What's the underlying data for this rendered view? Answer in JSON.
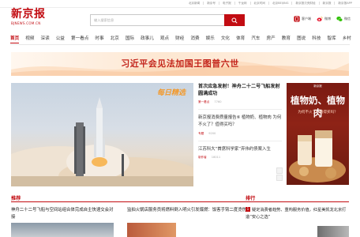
{
  "top_links": [
    "北京新闻",
    "新京号",
    "电子报",
    "千龙网",
    "北京时间",
    "北京BEIJING",
    "新京报贝壳财经",
    "新京报",
    "新京报APP"
  ],
  "logo": {
    "main": "新京报",
    "sub": "BJNEWS.COM.CN"
  },
  "search": {
    "placeholder": "输入搜索信息"
  },
  "header_tools": [
    {
      "label": "客户端",
      "icon": "phone-app-icon"
    },
    {
      "label": "微博",
      "icon": "weibo-icon"
    },
    {
      "label": "微信",
      "icon": "wechat-icon"
    }
  ],
  "nav": {
    "active": "首页",
    "items": [
      "首页",
      "视频",
      "深读",
      "公益",
      "第一看点",
      "时事",
      "北京",
      "国际",
      "政事儿",
      "观点",
      "财经",
      "消费",
      "娱乐",
      "文化",
      "体育",
      "汽车",
      "房产",
      "教育",
      "图说",
      "科技",
      "智库",
      "乡村"
    ]
  },
  "banner": {
    "text": "习近平会见法加国王图普六世"
  },
  "hero": {
    "tag": "每日精选"
  },
  "headline": {
    "title": "首次应急发射！神舟二十二号飞船发射圆满成功",
    "source": "第一看点",
    "count": "7760"
  },
  "news_items": [
    {
      "title": "新京报消费质量报告⑥ 植物奶、植物肉 为何不火了？值得买吗？",
      "source": "专题",
      "count": "9200"
    },
    {
      "title": "江苏科大“首席科学家”弃伟约债案入生",
      "source": "制作者",
      "count": "18011"
    }
  ],
  "poster": {
    "top": "新京报",
    "headline": "植物奶、植物肉",
    "sub": "为何不火了？值得买吗？"
  },
  "recommend": {
    "title": "推荐",
    "items": [
      "神舟二十二号飞船与空间站组合体完成自主快速交会对接",
      "监拍火锅店服务员将燃料倒入明火引发爆燃：饭客手臂二度烫伤"
    ]
  },
  "ranking": {
    "title": "排行",
    "items": [
      {
        "num": "1",
        "text": "疑定消费者趋势、重构服务价值，红星美凯龙北京打造“安心之选”"
      }
    ]
  },
  "colors": {
    "brand": "#c20c12",
    "banner_text": "#c3241a",
    "hero_tag": "#f29a2e"
  }
}
